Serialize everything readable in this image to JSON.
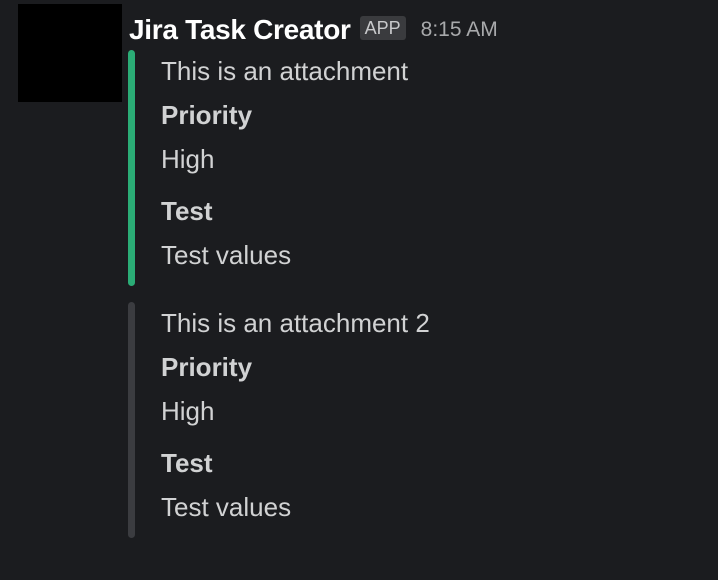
{
  "message": {
    "sender": "Jira Task Creator",
    "badge": "APP",
    "timestamp": "8:15 AM"
  },
  "attachments": [
    {
      "title": "This is an attachment",
      "color": "#2bac76",
      "fields": [
        {
          "label": "Priority",
          "value": "High"
        },
        {
          "label": "Test",
          "value": "Test values"
        }
      ]
    },
    {
      "title": "This is an attachment 2",
      "color": "#3b3c40",
      "fields": [
        {
          "label": "Priority",
          "value": "High"
        },
        {
          "label": "Test",
          "value": "Test values"
        }
      ]
    }
  ]
}
